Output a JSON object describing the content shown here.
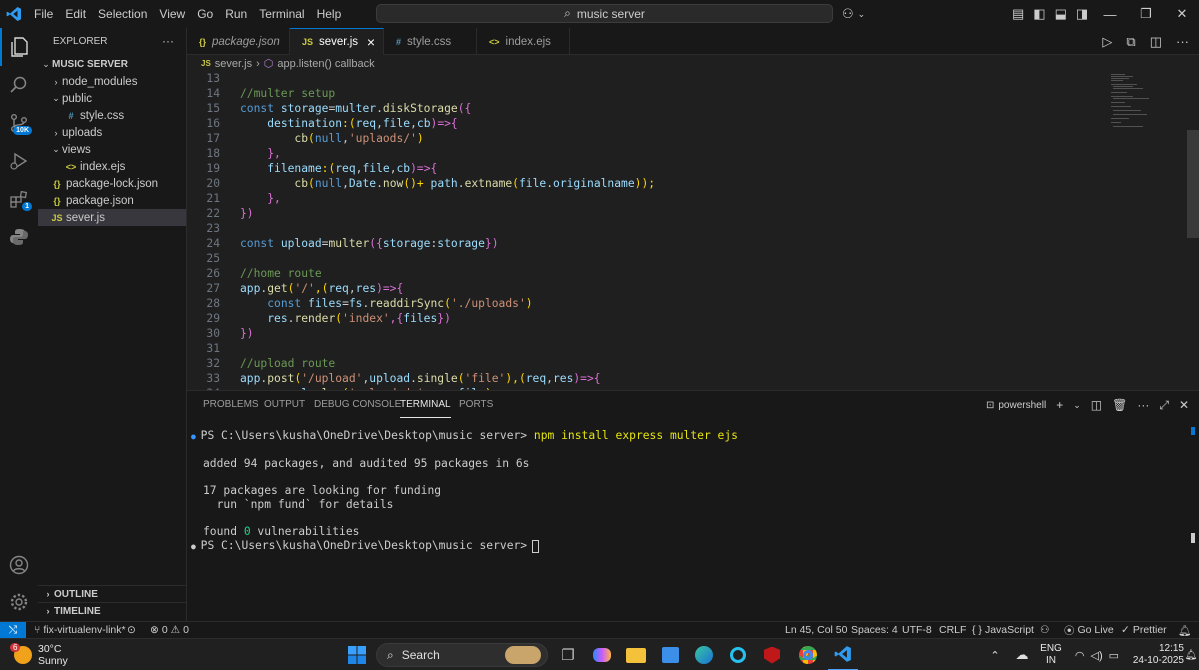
{
  "menu": [
    "File",
    "Edit",
    "Selection",
    "View",
    "Go",
    "Run",
    "Terminal",
    "Help"
  ],
  "search": {
    "text": "music server"
  },
  "explorer": {
    "title": "EXPLORER",
    "root": "MUSIC SERVER",
    "items": [
      {
        "label": "node_modules",
        "type": "folder",
        "open": false,
        "indent": 1
      },
      {
        "label": "public",
        "type": "folder",
        "open": true,
        "indent": 1
      },
      {
        "label": "style.css",
        "type": "css",
        "icon": "#",
        "indent": 2
      },
      {
        "label": "uploads",
        "type": "folder",
        "open": false,
        "indent": 1
      },
      {
        "label": "views",
        "type": "folder",
        "open": true,
        "indent": 1
      },
      {
        "label": "index.ejs",
        "type": "ejs",
        "icon": "<>",
        "indent": 2
      },
      {
        "label": "package-lock.json",
        "type": "json",
        "icon": "{}",
        "indent": 1
      },
      {
        "label": "package.json",
        "type": "json",
        "icon": "{}",
        "indent": 1
      },
      {
        "label": "sever.js",
        "type": "js",
        "icon": "JS",
        "indent": 1,
        "active": true
      }
    ],
    "outline": "OUTLINE",
    "timeline": "TIMELINE"
  },
  "activity_badges": {
    "source_control": "10K",
    "extensions": "1"
  },
  "tabs": [
    {
      "label": "package.json",
      "icon": "{}",
      "italic": true
    },
    {
      "label": "sever.js",
      "icon": "JS",
      "active": true,
      "close": "×"
    },
    {
      "label": "style.css",
      "icon": "#"
    },
    {
      "label": "index.ejs",
      "icon": "<>"
    }
  ],
  "breadcrumb": {
    "file": "sever.js",
    "symbol": "app.listen() callback"
  },
  "code": [
    {
      "n": "13",
      "t": ""
    },
    {
      "n": "14",
      "t": "//multer setup"
    },
    {
      "n": "15",
      "t": "const storage=multer.diskStorage({"
    },
    {
      "n": "16",
      "t": "    destination:(req,file,cb)=>{"
    },
    {
      "n": "17",
      "t": "        cb(null,'uplaods/')"
    },
    {
      "n": "18",
      "t": "    },"
    },
    {
      "n": "19",
      "t": "    filename:(req,file,cb)=>{"
    },
    {
      "n": "20",
      "t": "        cb(null,Date.now()+ path.extname(file.originalname));"
    },
    {
      "n": "21",
      "t": "    },"
    },
    {
      "n": "22",
      "t": "})"
    },
    {
      "n": "23",
      "t": ""
    },
    {
      "n": "24",
      "t": "const upload=multer({storage:storage})"
    },
    {
      "n": "25",
      "t": ""
    },
    {
      "n": "26",
      "t": "//home route"
    },
    {
      "n": "27",
      "t": "app.get('/',(req,res)=>{"
    },
    {
      "n": "28",
      "t": "    const files=fs.readdirSync('./uploads')"
    },
    {
      "n": "29",
      "t": "    res.render('index',{files})"
    },
    {
      "n": "30",
      "t": "})"
    },
    {
      "n": "31",
      "t": ""
    },
    {
      "n": "32",
      "t": "//upload route"
    },
    {
      "n": "33",
      "t": "app.post('/upload',upload.single('file'),(req,res)=>{"
    },
    {
      "n": "34",
      "t": "    console.log('uploaded:',req.file)"
    }
  ],
  "panel": {
    "tabs": [
      "PROBLEMS",
      "OUTPUT",
      "DEBUG CONSOLE",
      "TERMINAL",
      "PORTS"
    ],
    "active_tab": "TERMINAL",
    "shell": "powershell",
    "prompt": "PS C:\\Users\\kusha\\OneDrive\\Desktop\\music server>",
    "command": "npm install express multer ejs",
    "output": [
      "added 94 packages, and audited 95 packages in 6s",
      "",
      "17 packages are looking for funding",
      "  run `npm fund` for details",
      "",
      "found 0 vulnerabilities"
    ]
  },
  "status": {
    "branch": "fix-virtualenv-link*",
    "errors": "0",
    "warnings": "0",
    "position": "Ln 45, Col 50",
    "spaces": "Spaces: 4",
    "encoding": "UTF-8",
    "eol": "CRLF",
    "language": "JavaScript",
    "golive": "Go Live",
    "prettier": "Prettier"
  },
  "taskbar": {
    "weather_temp": "30°C",
    "weather_desc": "Sunny",
    "weather_badge": "6",
    "search": "Search",
    "lang1": "ENG",
    "lang2": "IN",
    "time": "12:15",
    "date": "24-10-2025"
  }
}
